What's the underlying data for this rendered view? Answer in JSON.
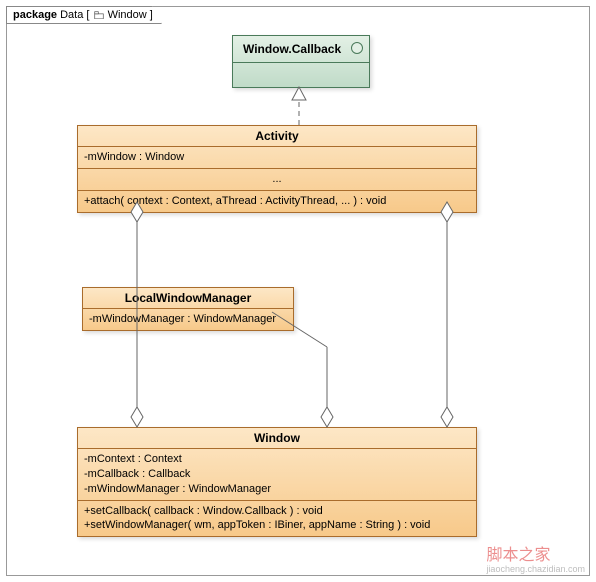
{
  "package": {
    "label_prefix": "package",
    "name": "Data",
    "bracket_open": "[",
    "bracket_close": "]",
    "inner": "Window"
  },
  "interface": {
    "name": "Window.Callback"
  },
  "activity": {
    "name": "Activity",
    "attrs": [
      "-mWindow : Window"
    ],
    "dots": "...",
    "ops": [
      "+attach( context : Context, aThread : ActivityThread, ... ) : void"
    ]
  },
  "localwm": {
    "name": "LocalWindowManager",
    "attrs": [
      "-mWindowManager : WindowManager"
    ]
  },
  "window": {
    "name": "Window",
    "attrs": [
      "-mContext : Context",
      "-mCallback : Callback",
      "-mWindowManager : WindowManager"
    ],
    "ops": [
      "+setCallback( callback : Window.Callback ) : void",
      "+setWindowManager( wm, appToken : IBiner, appName : String ) : void"
    ]
  },
  "watermark": {
    "main": "脚本之家",
    "sub": "jiaocheng.chazidian.com"
  }
}
